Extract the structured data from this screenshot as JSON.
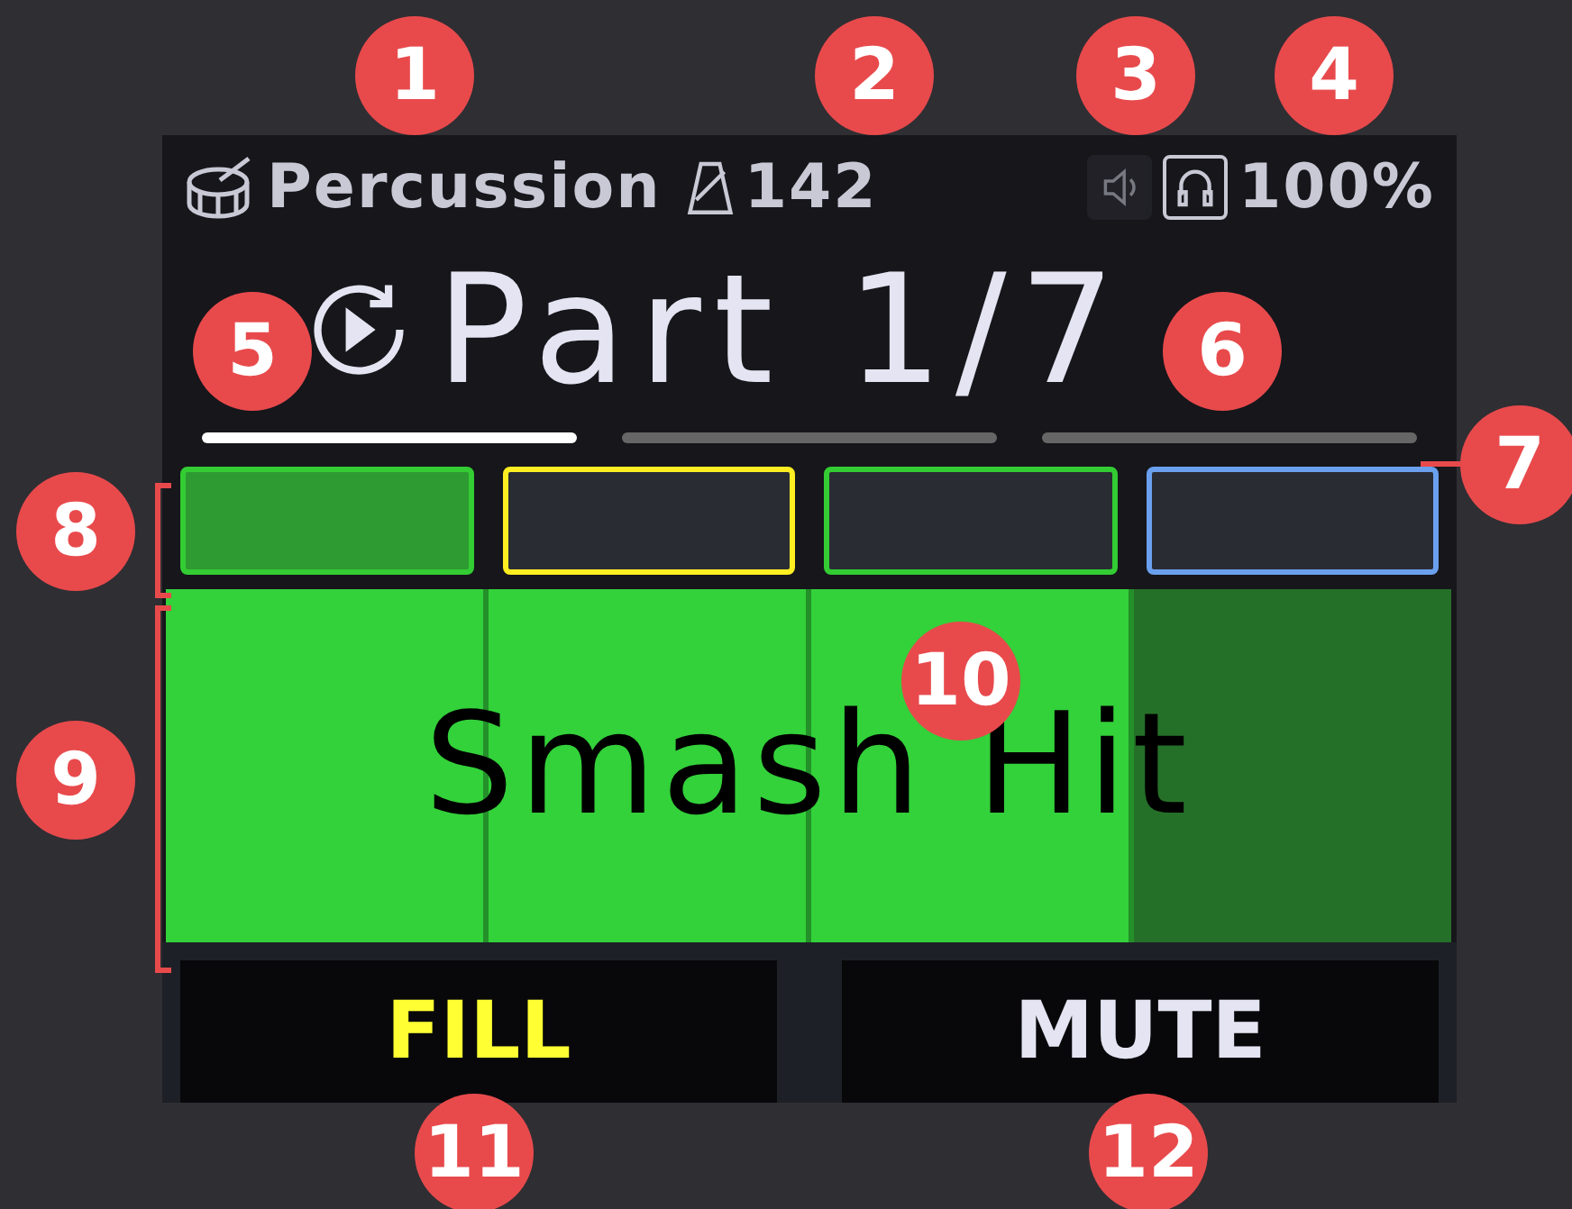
{
  "status_bar": {
    "instrument": "Percussion",
    "tempo": "142",
    "speaker_on": false,
    "headphones_on": true,
    "volume": "100%"
  },
  "part": {
    "label": "Part 1/7"
  },
  "sections": [
    {
      "active": true
    },
    {
      "active": false
    },
    {
      "active": false
    }
  ],
  "patterns": [
    {
      "color": "#33cc33",
      "selected": true
    },
    {
      "color": "#ffee22",
      "selected": false
    },
    {
      "color": "#33cc33",
      "selected": false
    },
    {
      "color": "#6aa0ee",
      "selected": false
    }
  ],
  "main_pad": {
    "label": "Smash Hit",
    "beats": [
      {
        "lit": true
      },
      {
        "lit": true
      },
      {
        "lit": true
      },
      {
        "lit": false
      }
    ]
  },
  "buttons": [
    {
      "label": "FILL",
      "kind": "fill"
    },
    {
      "label": "MUTE",
      "kind": "mute"
    }
  ],
  "callouts": [
    "1",
    "2",
    "3",
    "4",
    "5",
    "6",
    "7",
    "8",
    "9",
    "10",
    "11",
    "12"
  ]
}
